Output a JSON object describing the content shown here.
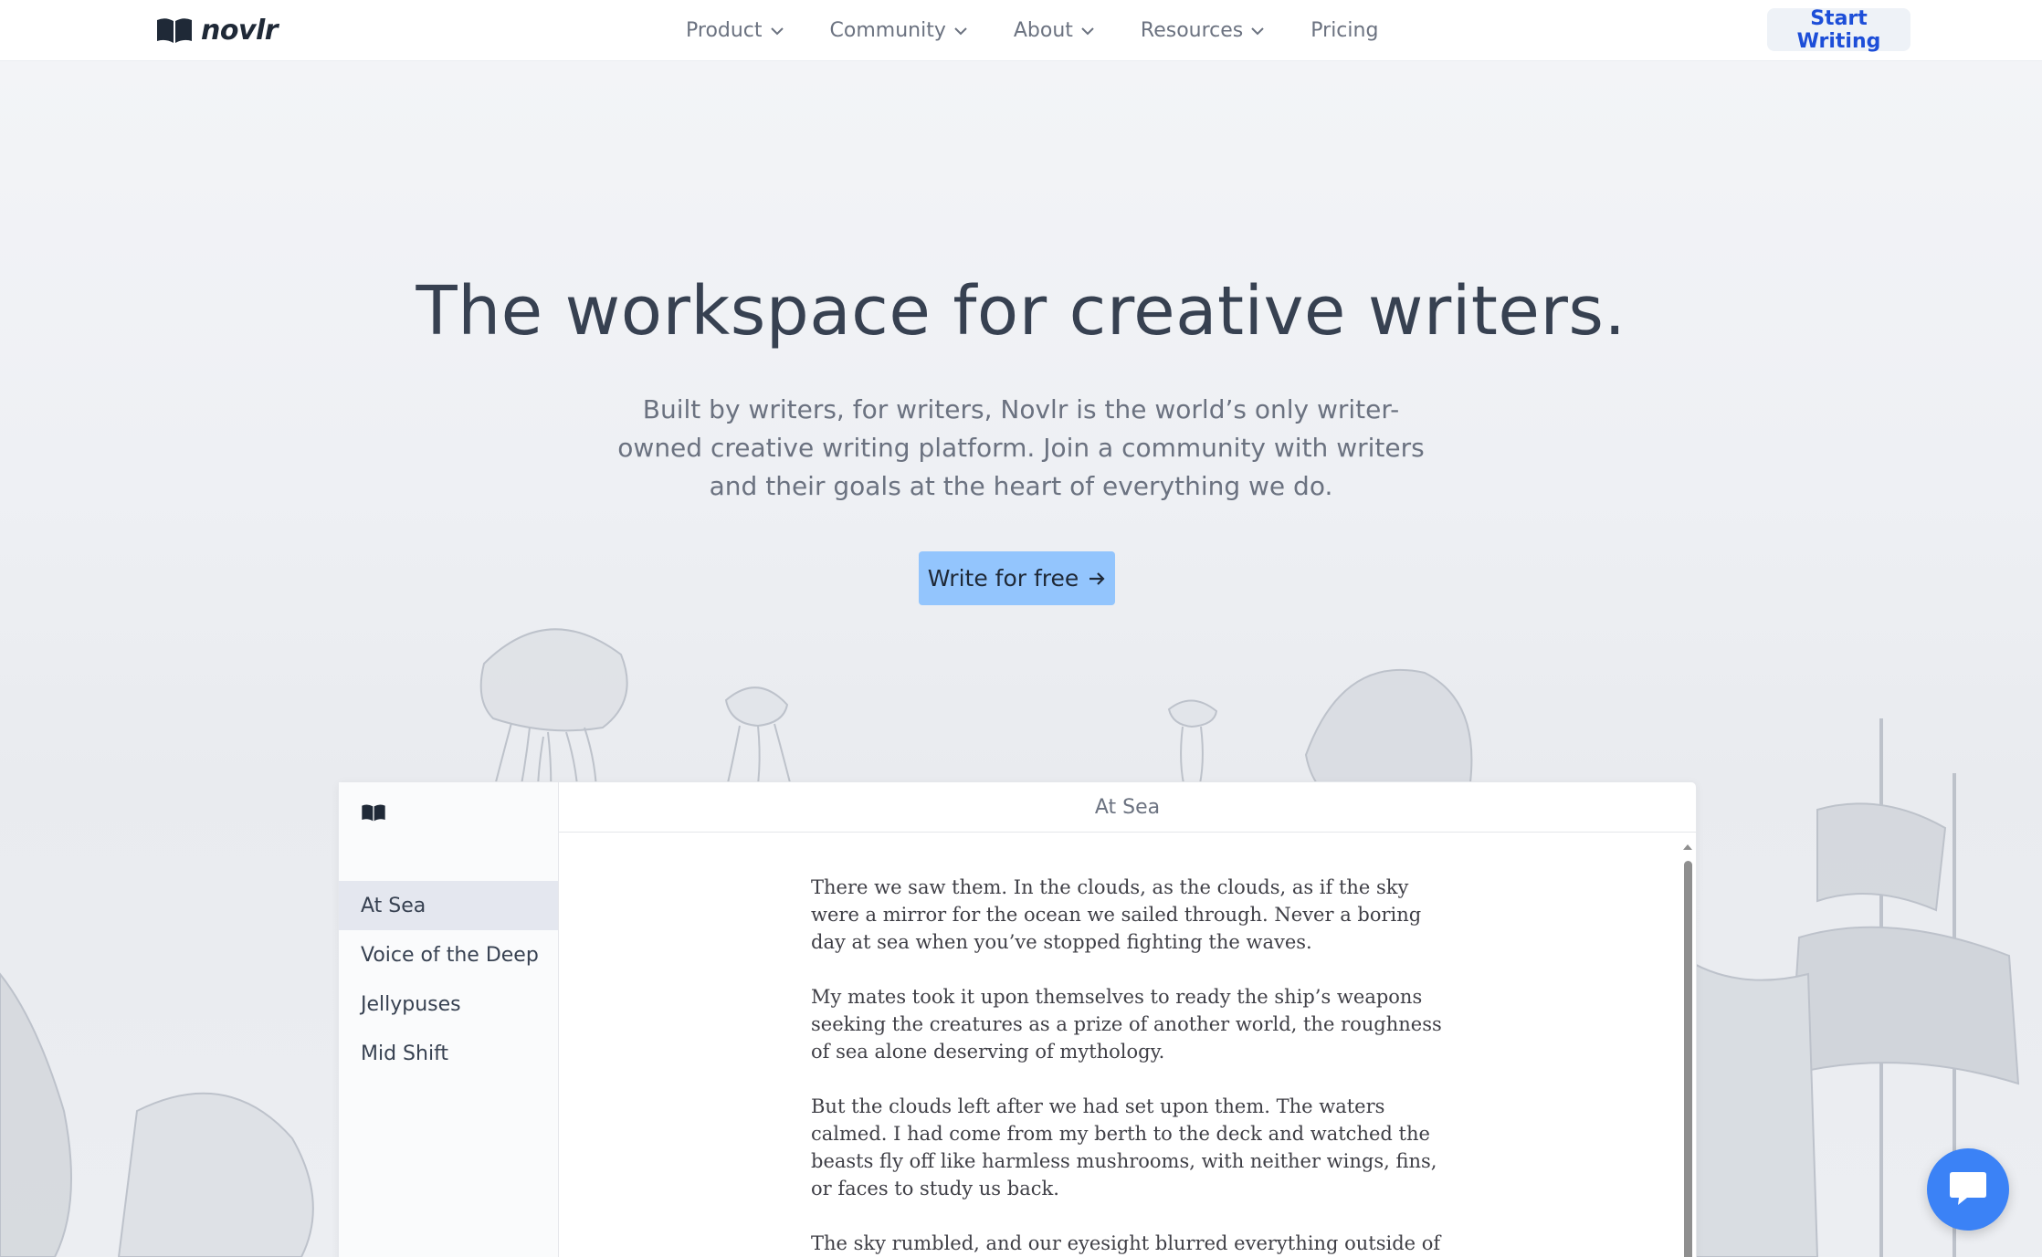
{
  "nav": {
    "logo_text": "novlr",
    "items": [
      {
        "label": "Product",
        "has_dropdown": true
      },
      {
        "label": "Community",
        "has_dropdown": true
      },
      {
        "label": "About",
        "has_dropdown": true
      },
      {
        "label": "Resources",
        "has_dropdown": true
      },
      {
        "label": "Pricing",
        "has_dropdown": false
      }
    ],
    "cta_label": "Start Writing"
  },
  "hero": {
    "title": "The workspace for creative writers.",
    "subtitle": "Built by writers, for writers, Novlr is the world’s only writer-owned creative writing platform. Join a community with writers and their goals at the heart of everything we do.",
    "cta_label": "Write for free"
  },
  "editor": {
    "document_title": "At Sea",
    "chapters": [
      {
        "label": "At Sea",
        "active": true
      },
      {
        "label": "Voice of the Deep",
        "active": false
      },
      {
        "label": "Jellypuses",
        "active": false
      },
      {
        "label": "Mid Shift",
        "active": false
      }
    ],
    "paragraphs": [
      "There we saw them. In the clouds, as the clouds, as if the sky were a mirror for the ocean we sailed through. Never a boring day at sea when you’ve stopped fighting the waves.",
      "My mates took it upon themselves to ready the ship’s weapons seeking the creatures as a prize of another world, the roughness of sea alone deserving of mythology.",
      "But the clouds left after we had set upon them. The waters calmed. I had come from my berth to the deck and watched the beasts fly off like harmless mushrooms, with neither wings, fins, or faces to study us back.",
      "The sky rumbled, and our eyesight blurred everything outside of"
    ]
  },
  "icons": {
    "logo": "open-book-icon",
    "dropdown": "chevron-down-icon",
    "cta": "arrow-right-icon",
    "chat": "chat-bubble-icon"
  },
  "colors": {
    "accent": "#1d4ed8",
    "cta_bg": "#93c5fd",
    "chat_bg": "#3b82f6",
    "title_text": "#374151"
  }
}
